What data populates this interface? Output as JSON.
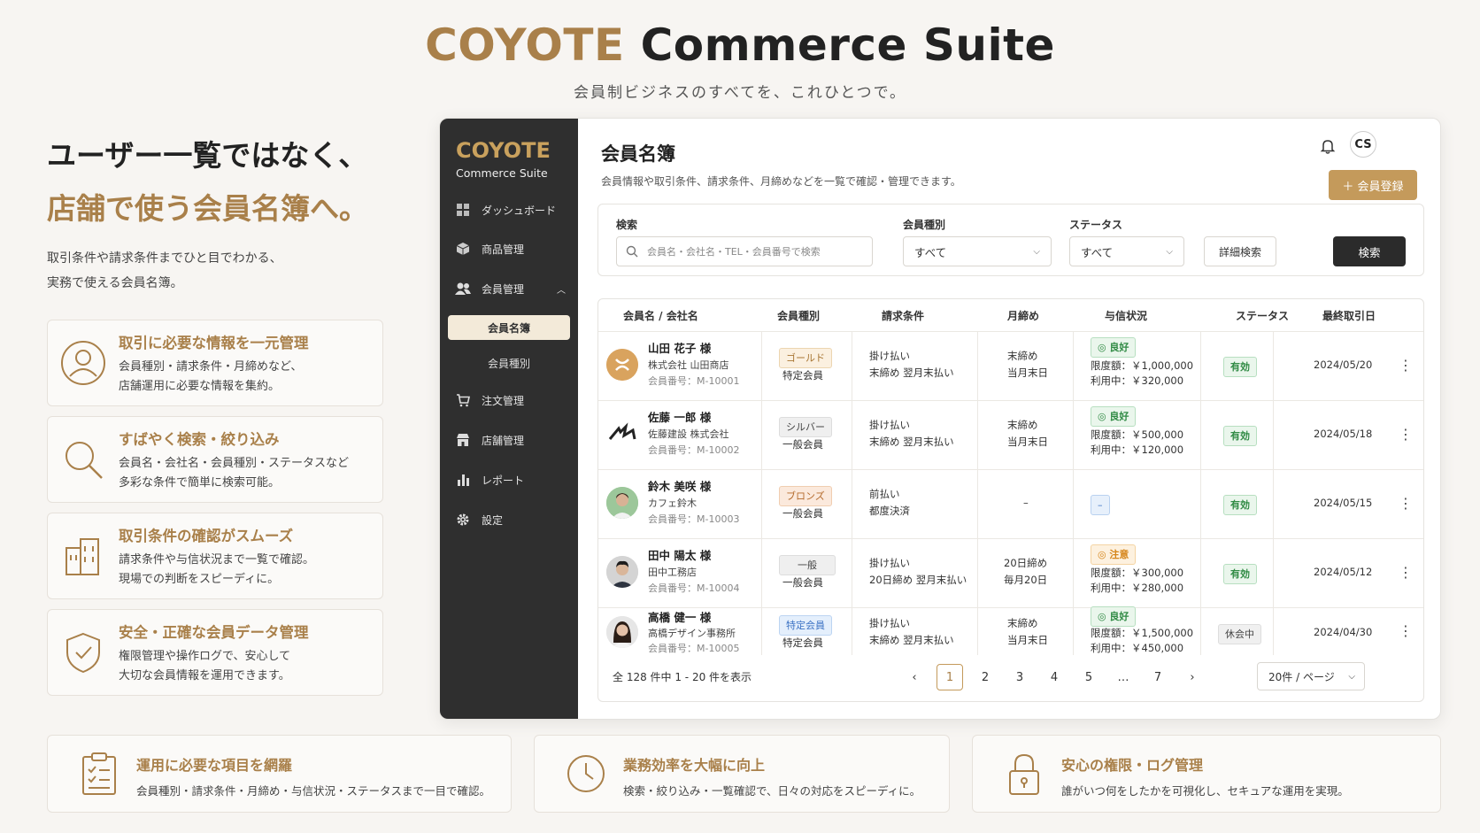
{
  "header": {
    "brand": "COYOTE",
    "title_rest": "Commerce Suite",
    "subtitle": "会員制ビジネスのすべてを、これひとつで。"
  },
  "left": {
    "headline_1": "ユーザー一覧ではなく、",
    "headline_2": "店舗で使う会員名簿へ。",
    "desc_1": "取引条件や請求条件までひと目でわかる、",
    "desc_2": "実務で使える会員名簿。",
    "features": [
      {
        "title": "取引に必要な情報を一元管理",
        "desc_1": "会員種別・請求条件・月締めなど、",
        "desc_2": "店舗運用に必要な情報を集約。",
        "icon": "user-circle-icon"
      },
      {
        "title": "すばやく検索・絞り込み",
        "desc_1": "会員名・会社名・会員種別・ステータスなど",
        "desc_2": "多彩な条件で簡単に検索可能。",
        "icon": "search-icon"
      },
      {
        "title": "取引条件の確認がスムーズ",
        "desc_1": "請求条件や与信状況まで一覧で確認。",
        "desc_2": "現場での判断をスピーディに。",
        "icon": "building-icon"
      },
      {
        "title": "安全・正確な会員データ管理",
        "desc_1": "権限管理や操作ログで、安心して",
        "desc_2": "大切な会員情報を運用できます。",
        "icon": "shield-check-icon"
      }
    ]
  },
  "sidebar": {
    "logo_1": "COYOTE",
    "logo_2": "Commerce Suite",
    "items": [
      {
        "label": "ダッシュボード",
        "icon": "grid-icon"
      },
      {
        "label": "商品管理",
        "icon": "box-icon"
      },
      {
        "label": "会員管理",
        "icon": "users-icon"
      },
      {
        "label": "注文管理",
        "icon": "cart-icon"
      },
      {
        "label": "店舗管理",
        "icon": "store-icon"
      },
      {
        "label": "レポート",
        "icon": "bar-chart-icon"
      },
      {
        "label": "設定",
        "icon": "gear-icon"
      }
    ],
    "sub_items": [
      {
        "label": "会員名簿"
      },
      {
        "label": "会員種別"
      }
    ]
  },
  "page": {
    "title": "会員名簿",
    "desc": "会員情報や取引条件、請求条件、月締めなどを一覧で確認・管理できます。",
    "user_initials": "CS",
    "add_button": "＋ 会員登録"
  },
  "filters": {
    "search_label": "検索",
    "search_placeholder": "会員名・会社名・TEL・会員番号で検索",
    "type_label": "会員種別",
    "type_value": "すべて",
    "status_label": "ステータス",
    "status_value": "すべて",
    "detail_button": "詳細検索",
    "search_button": "検索"
  },
  "table": {
    "headers": [
      "会員名 / 会社名",
      "会員種別",
      "請求条件",
      "月締め",
      "与信状況",
      "ステータス",
      "最終取引日"
    ],
    "rows": [
      {
        "name": "山田 花子 様",
        "company": "株式会社 山田商店",
        "id": "会員番号：M-10001",
        "type_badge": "ゴールド",
        "type_class": "gold",
        "type_sub": "特定会員",
        "billing_1": "掛け払い",
        "billing_2": "末締め 翌月末払い",
        "close_1": "末締め",
        "close_2": "当月末日",
        "credit_badge": "◎ 良好",
        "credit_class": "ok",
        "limit": "限度額：￥1,000,000",
        "used": "利用中：￥320,000",
        "status": "有効",
        "status_class": "active",
        "last": "2024/05/20"
      },
      {
        "name": "佐藤 一郎 様",
        "company": "佐藤建設 株式会社",
        "id": "会員番号：M-10002",
        "type_badge": "シルバー",
        "type_class": "silver",
        "type_sub": "一般会員",
        "billing_1": "掛け払い",
        "billing_2": "末締め 翌月末払い",
        "close_1": "末締め",
        "close_2": "当月末日",
        "credit_badge": "◎ 良好",
        "credit_class": "ok",
        "limit": "限度額：￥500,000",
        "used": "利用中：￥120,000",
        "status": "有効",
        "status_class": "active",
        "last": "2024/05/18"
      },
      {
        "name": "鈴木 美咲 様",
        "company": "カフェ鈴木",
        "id": "会員番号：M-10003",
        "type_badge": "ブロンズ",
        "type_class": "bronze",
        "type_sub": "一般会員",
        "billing_1": "前払い",
        "billing_2": "都度決済",
        "close_1": "–",
        "close_2": "",
        "credit_badge": "–",
        "credit_class": "dash",
        "limit": "",
        "used": "",
        "status": "有効",
        "status_class": "active",
        "last": "2024/05/15"
      },
      {
        "name": "田中 陽太 様",
        "company": "田中工務店",
        "id": "会員番号：M-10004",
        "type_badge": "一般",
        "type_class": "normal",
        "type_sub": "一般会員",
        "billing_1": "掛け払い",
        "billing_2": "20日締め 翌月末払い",
        "close_1": "20日締め",
        "close_2": "毎月20日",
        "credit_badge": "◎ 注意",
        "credit_class": "warn",
        "limit": "限度額：￥300,000",
        "used": "利用中：￥280,000",
        "status": "有効",
        "status_class": "active",
        "last": "2024/05/12"
      },
      {
        "name": "高橋 健一 様",
        "company": "高橋デザイン事務所",
        "id": "会員番号：M-10005",
        "type_badge": "特定会員",
        "type_class": "special",
        "type_sub": "特定会員",
        "billing_1": "掛け払い",
        "billing_2": "末締め 翌月末払い",
        "close_1": "末締め",
        "close_2": "当月末日",
        "credit_badge": "◎ 良好",
        "credit_class": "ok",
        "limit": "限度額：￥1,500,000",
        "used": "利用中：￥450,000",
        "status": "休会中",
        "status_class": "paused",
        "last": "2024/04/30"
      }
    ],
    "summary": "全 128 件中 1 - 20 件を表示",
    "pages": [
      "1",
      "2",
      "3",
      "4",
      "5",
      "…",
      "7"
    ],
    "current_page": "1",
    "per_page": "20件 / ページ"
  },
  "bottom": [
    {
      "title": "運用に必要な項目を網羅",
      "desc": "会員種別・請求条件・月締め・与信状況・ステータスまで一目で確認。",
      "icon": "checklist-icon"
    },
    {
      "title": "業務効率を大幅に向上",
      "desc": "検索・絞り込み・一覧確認で、日々の対応をスピーディに。",
      "icon": "clock-icon"
    },
    {
      "title": "安心の権限・ログ管理",
      "desc": "誰がいつ何をしたかを可視化し、セキュアな運用を実現。",
      "icon": "lock-icon"
    }
  ],
  "colors": {
    "accent": "#a9804a",
    "sidebar": "#2f2f2f",
    "button": "#c49a5b"
  }
}
